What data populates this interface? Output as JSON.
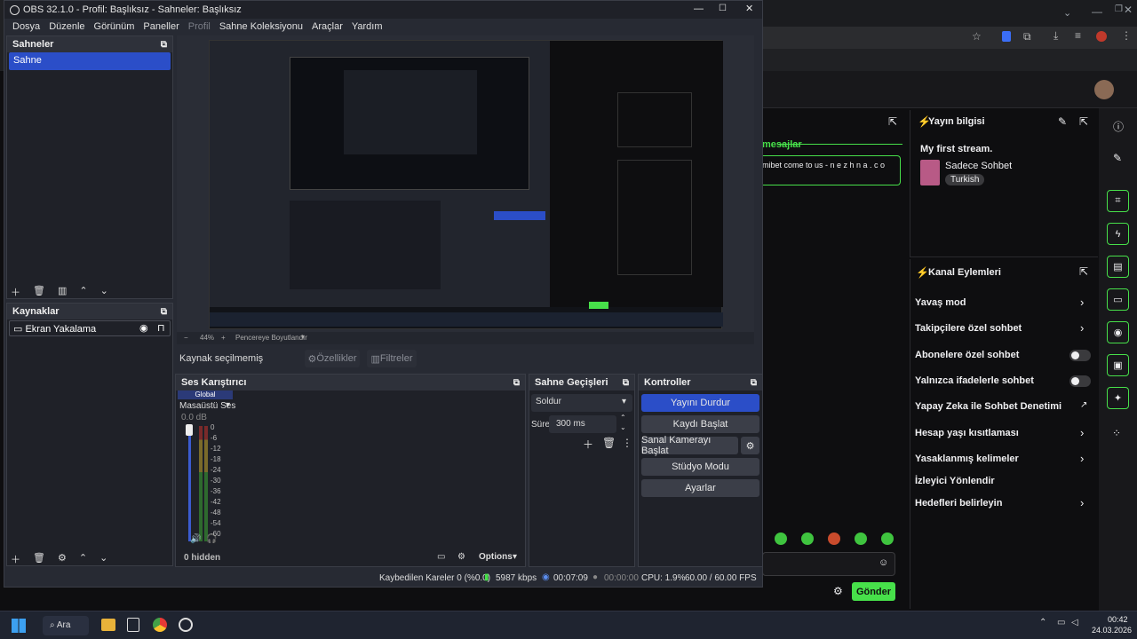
{
  "obs": {
    "title": "OBS 32.1.0 - Profil: Başlıksız - Sahneler: Başlıksız",
    "menu": [
      "Dosya",
      "Düzenle",
      "Görünüm",
      "Paneller",
      "Profil",
      "Sahne Koleksiyonu",
      "Araçlar",
      "Yardım"
    ],
    "scenes": {
      "title": "Sahneler",
      "items": [
        "Sahne"
      ]
    },
    "sources": {
      "title": "Kaynaklar",
      "items": [
        "Ekran Yakalama"
      ]
    },
    "preview": {
      "zoom": "44%",
      "fit_label": "Pencereye Boyutlandır"
    },
    "context_bar": {
      "no_source": "Kaynak seçilmemiş",
      "properties": "Özellikler",
      "filters": "Filtreler"
    },
    "mixer": {
      "title": "Ses Karıştırıcı",
      "global": "Global",
      "channel": "Masaüstü Ses",
      "db": "0.0 dB",
      "ticks": [
        "0",
        "-6",
        "-12",
        "-18",
        "-24",
        "-30",
        "-36",
        "-42",
        "-48",
        "-54",
        "-60"
      ],
      "hidden": "0 hidden",
      "options": "Options"
    },
    "transitions": {
      "title": "Sahne Geçişleri",
      "selected": "Soldur",
      "duration_label": "Süre",
      "duration": "300 ms"
    },
    "controls": {
      "title": "Kontroller",
      "stop_stream": "Yayını Durdur",
      "start_record": "Kaydı Başlat",
      "virtual_cam": "Sanal Kamerayı Başlat",
      "studio_mode": "Stüdyo Modu",
      "settings": "Ayarlar"
    },
    "status": {
      "dropped": "Kaybedilen Kareler 0 (%0.0)",
      "bitrate": "5987 kbps",
      "stream_time": "00:07:09",
      "rec_time": "00:00:00",
      "cpu": "CPU: 1.9%",
      "fps": "60.00 / 60.00 FPS"
    }
  },
  "twitch": {
    "stream_info": {
      "title": "Yayın bilgisi",
      "stream_title": "My first stream.",
      "category": "Sadece Sohbet",
      "tag": "Turkish"
    },
    "chat": {
      "header": "mesajlar",
      "message": "mibet come to us - n e z h n a . c o",
      "send": "Gönder"
    },
    "channel_actions": {
      "title": "Kanal Eylemleri",
      "items": [
        "Yavaş mod",
        "Takipçilere özel sohbet",
        "Abonelere özel sohbet",
        "Yalnızca ifadelerle sohbet",
        "Yapay Zeka ile Sohbet Denetimi",
        "Hesap yaşı kısıtlaması",
        "Yasaklanmış kelimeler",
        "İzleyici Yönlendir",
        "Hedefleri belirleyin"
      ]
    }
  },
  "taskbar": {
    "search": "Ara",
    "time": "00:42",
    "date": "24.03.2026"
  },
  "colors": {
    "accent": "#2b4ec8",
    "twitch_green": "#47e04a",
    "obs_bg": "#272a33"
  }
}
